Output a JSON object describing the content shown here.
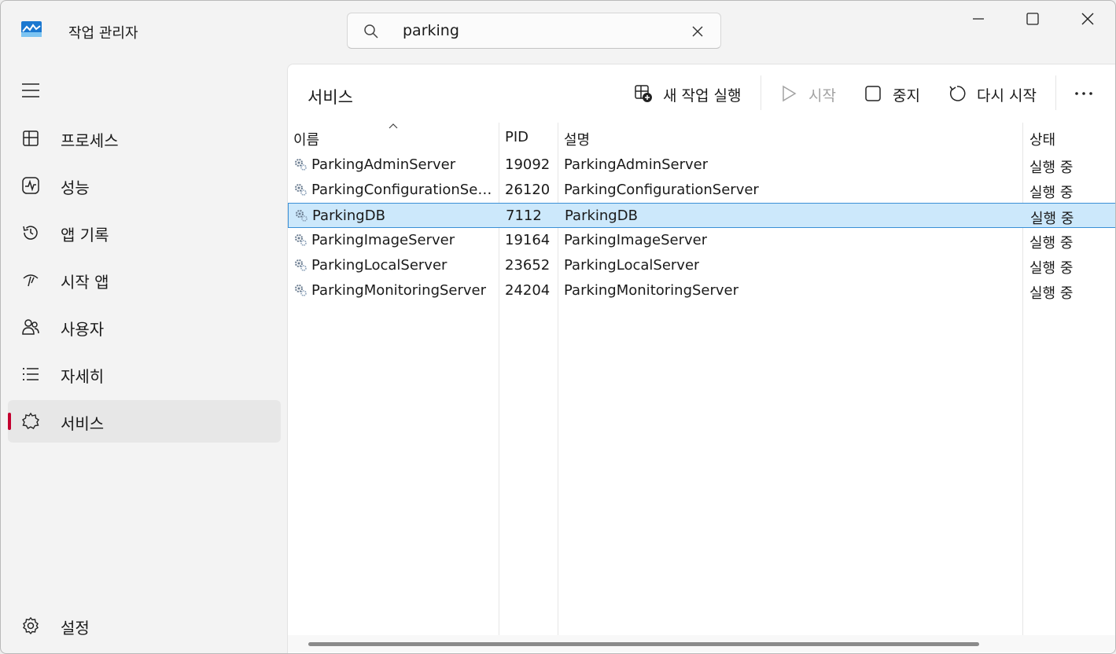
{
  "app": {
    "title": "작업 관리자",
    "icon": "task-manager-icon"
  },
  "search": {
    "value": "parking",
    "icon": "search-icon",
    "clear_icon": "close-icon"
  },
  "window_controls": {
    "minimize": "minimize-icon",
    "maximize": "maximize-icon",
    "close": "close-icon"
  },
  "sidebar": {
    "items": [
      {
        "label": "프로세스",
        "icon": "processes-icon"
      },
      {
        "label": "성능",
        "icon": "performance-icon"
      },
      {
        "label": "앱 기록",
        "icon": "history-icon"
      },
      {
        "label": "시작 앱",
        "icon": "startup-icon"
      },
      {
        "label": "사용자",
        "icon": "users-icon"
      },
      {
        "label": "자세히",
        "icon": "details-icon"
      },
      {
        "label": "서비스",
        "icon": "services-icon",
        "active": true
      }
    ],
    "settings": {
      "label": "설정",
      "icon": "settings-icon"
    }
  },
  "main": {
    "title": "서비스",
    "toolbar": {
      "new_task": "새 작업 실행",
      "start": "시작",
      "stop": "중지",
      "restart": "다시 시작"
    }
  },
  "table": {
    "columns": [
      "이름",
      "PID",
      "설명",
      "상태"
    ],
    "rows": [
      {
        "name": "ParkingAdminServer",
        "pid": "19092",
        "desc": "ParkingAdminServer",
        "status": "실행 중"
      },
      {
        "name": "ParkingConfigurationServer",
        "pid": "26120",
        "desc": "ParkingConfigurationServer",
        "status": "실행 중"
      },
      {
        "name": "ParkingDB",
        "pid": "7112",
        "desc": "ParkingDB",
        "status": "실행 중"
      },
      {
        "name": "ParkingImageServer",
        "pid": "19164",
        "desc": "ParkingImageServer",
        "status": "실행 중"
      },
      {
        "name": "ParkingLocalServer",
        "pid": "23652",
        "desc": "ParkingLocalServer",
        "status": "실행 중"
      },
      {
        "name": "ParkingMonitoringServer",
        "pid": "24204",
        "desc": "ParkingMonitoringServer",
        "status": "실행 중"
      }
    ],
    "selected_index": 2
  },
  "colors": {
    "accent": "#c3002f",
    "selection": "#cce8fb",
    "selection_border": "#3a8fd6"
  }
}
